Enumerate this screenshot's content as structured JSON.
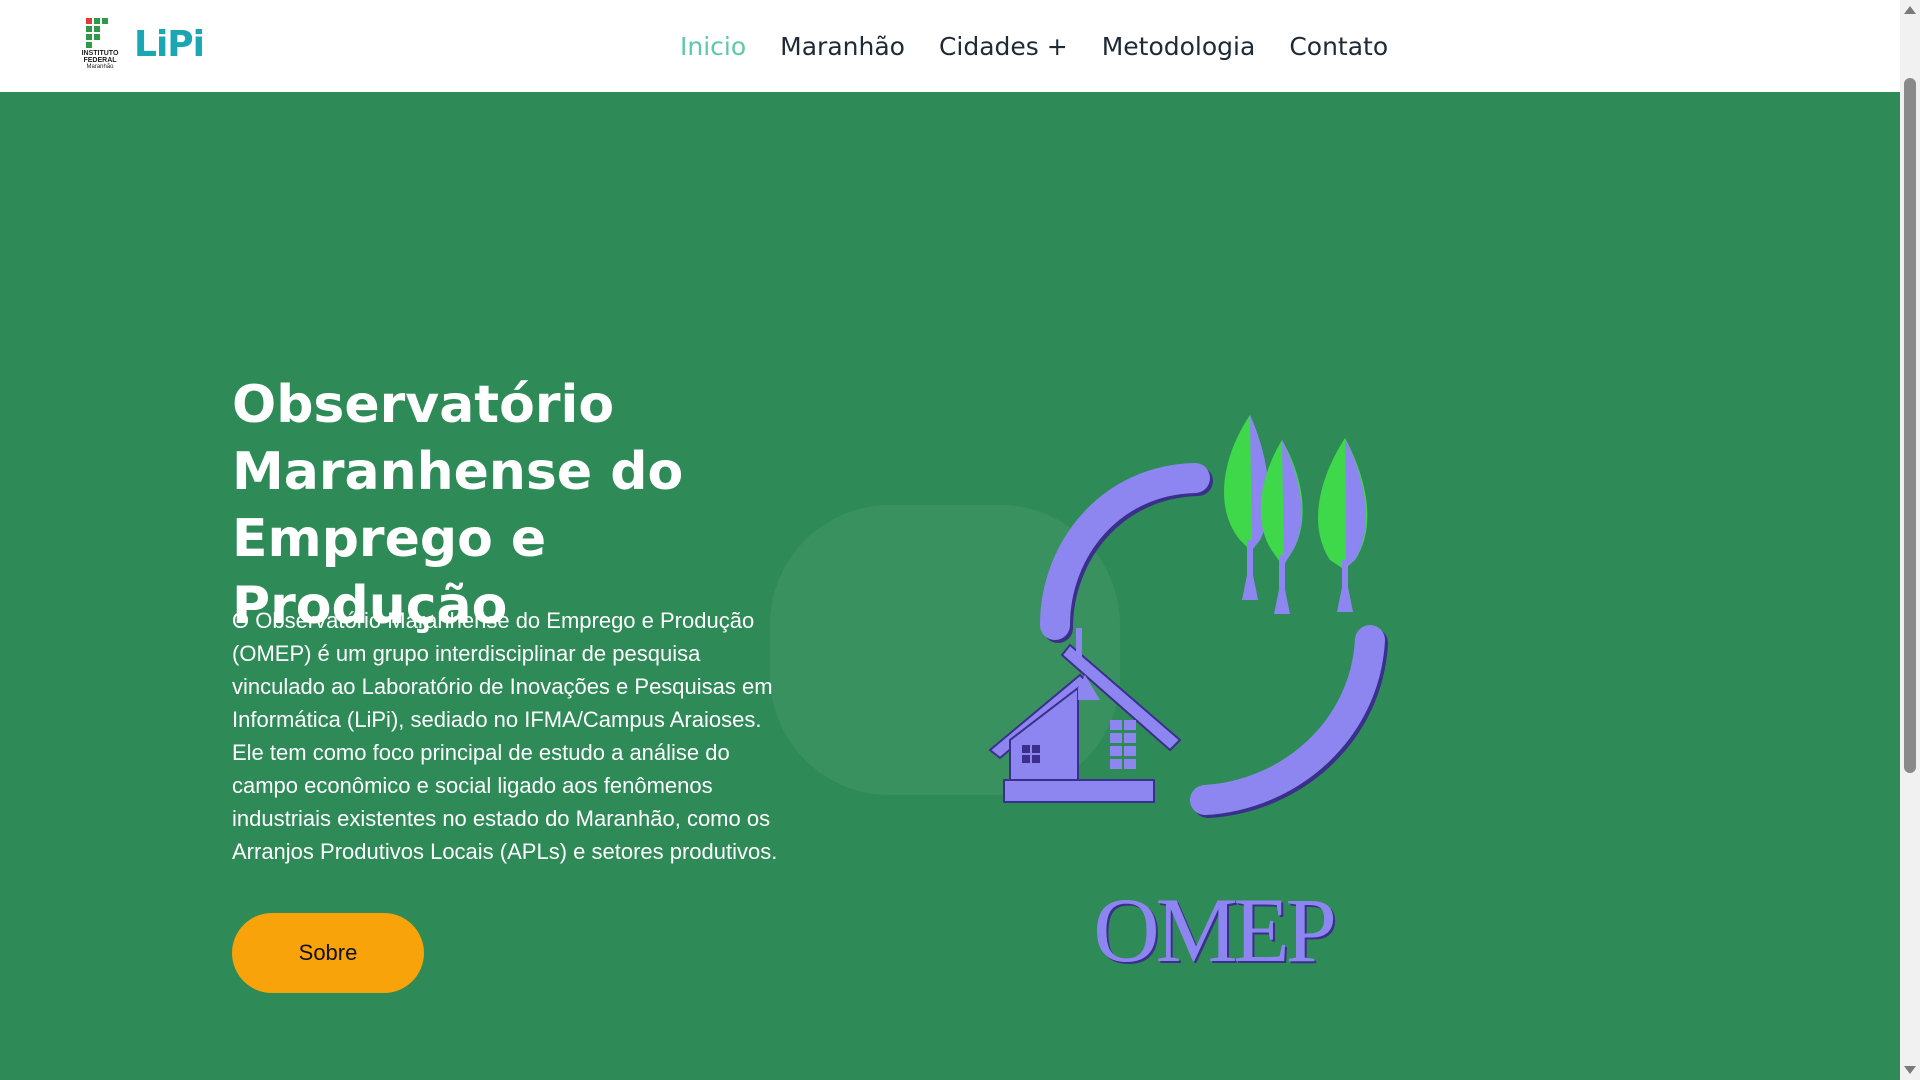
{
  "header": {
    "logo_institute_text": [
      "INSTITUTO",
      "FEDERAL",
      "Maranhão"
    ],
    "logo_lipi": "LiPi",
    "nav": [
      {
        "label": "Inicio",
        "active": true
      },
      {
        "label": "Maranhão",
        "active": false
      },
      {
        "label": "Cidades +",
        "active": false
      },
      {
        "label": "Metodologia",
        "active": false
      },
      {
        "label": "Contato",
        "active": false
      }
    ]
  },
  "hero": {
    "title": "Observatório Maranhense do Emprego e Produção",
    "description": "O Observatório Maranhense do Emprego e Produção (OMEP) é um grupo interdisciplinar de pesquisa vinculado ao Laboratório de Inovações e Pesquisas em Informática (LiPi), sediado no IFMA/Campus Araioses. Ele tem como foco principal de estudo a análise do campo econômico e social ligado aos fenômenos industriais existentes no estado do Maranhão, como os Arranjos Produtivos Locais (APLs) e setores produtivos.",
    "button_label": "Sobre",
    "logo_text": "OMEP"
  },
  "colors": {
    "background": "#2e8b57",
    "nav_active": "#5ec9a8",
    "button": "#f8a30a",
    "logo_purple": "#8e86f0",
    "leaf_green": "#3ed84a"
  },
  "icons": {
    "house": "house-icon",
    "trees": "trees-icon",
    "cycle_arrows": "cycle-arrows-icon"
  }
}
